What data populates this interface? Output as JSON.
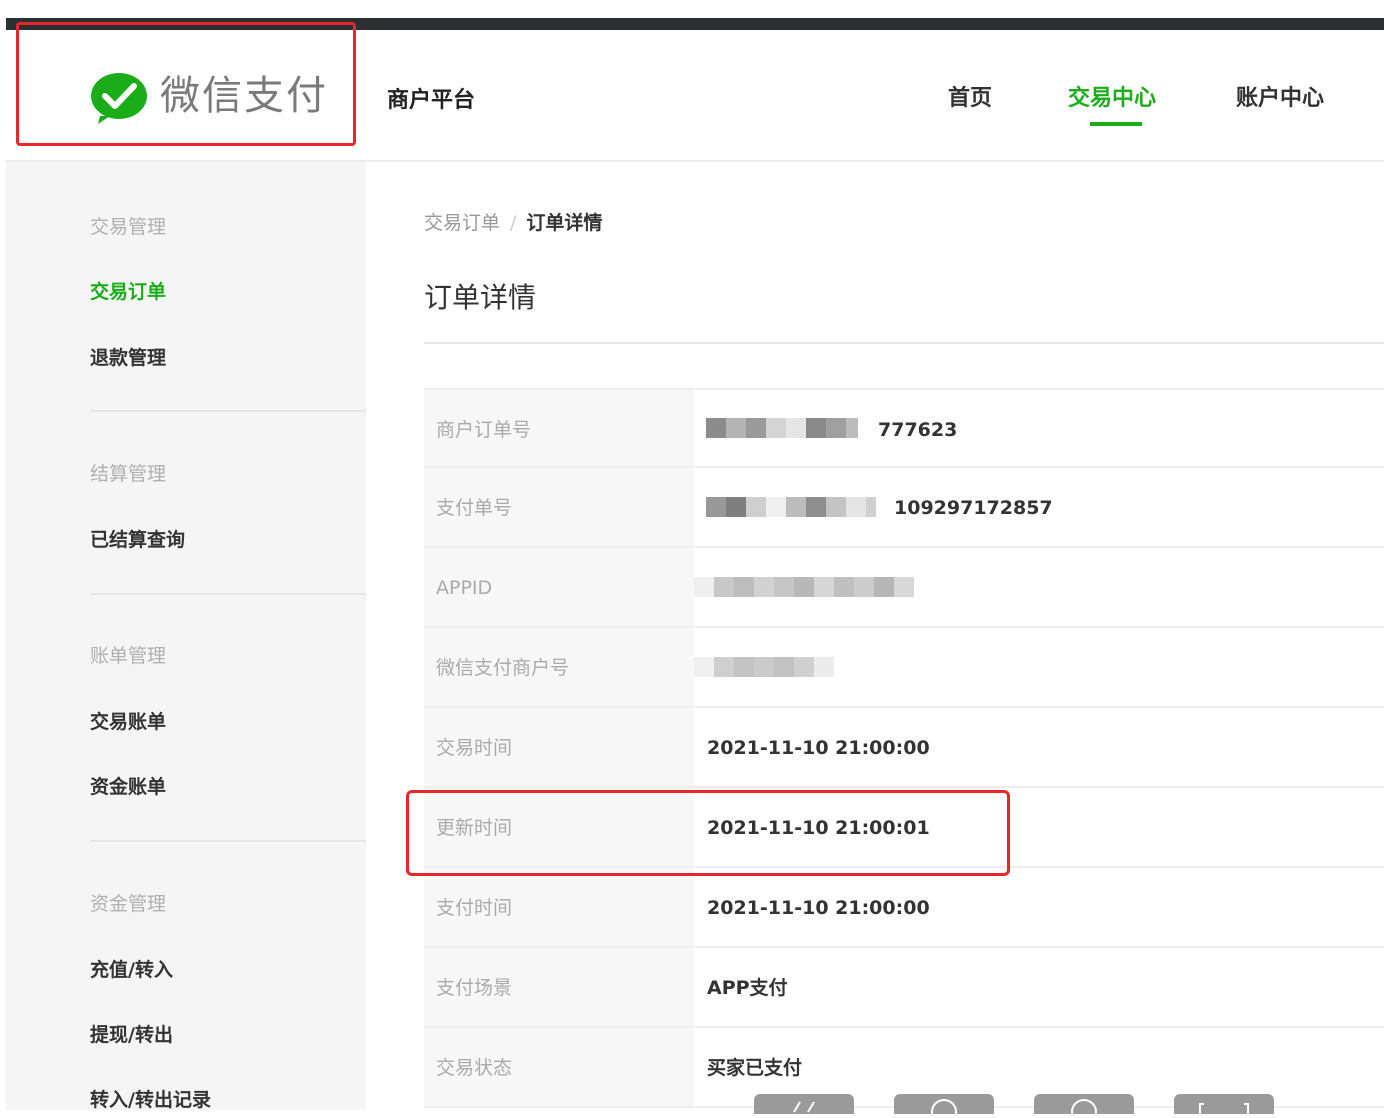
{
  "header": {
    "logo_text": "微信支付",
    "platform": "商户平台",
    "nav": [
      {
        "label": "首页",
        "active": false
      },
      {
        "label": "交易中心",
        "active": true
      },
      {
        "label": "账户中心",
        "active": false
      }
    ]
  },
  "sidebar": {
    "groups": [
      {
        "title": "交易管理",
        "items": [
          {
            "label": "交易订单",
            "active": true
          },
          {
            "label": "退款管理",
            "active": false
          }
        ]
      },
      {
        "title": "结算管理",
        "items": [
          {
            "label": "已结算查询",
            "active": false
          }
        ]
      },
      {
        "title": "账单管理",
        "items": [
          {
            "label": "交易账单",
            "active": false
          },
          {
            "label": "资金账单",
            "active": false
          }
        ]
      },
      {
        "title": "资金管理",
        "items": [
          {
            "label": "充值/转入",
            "active": false
          },
          {
            "label": "提现/转出",
            "active": false
          },
          {
            "label": "转入/转出记录",
            "active": false
          }
        ]
      }
    ]
  },
  "breadcrumb": {
    "parent": "交易订单",
    "separator": "/",
    "current": "订单详情"
  },
  "page_title": "订单详情",
  "details": [
    {
      "label": "商户订单号",
      "value": "777623",
      "masked": true
    },
    {
      "label": "支付单号",
      "value": "109297172857",
      "masked": true
    },
    {
      "label": "APPID",
      "value": "",
      "masked": true
    },
    {
      "label": "微信支付商户号",
      "value": "",
      "masked": true
    },
    {
      "label": "交易时间",
      "value": "2021-11-10 21:00:00",
      "masked": false
    },
    {
      "label": "更新时间",
      "value": "2021-11-10 21:00:01",
      "masked": false
    },
    {
      "label": "支付时间",
      "value": "2021-11-10 21:00:00",
      "masked": false
    },
    {
      "label": "支付场景",
      "value": "APP支付",
      "masked": false
    },
    {
      "label": "交易状态",
      "value": "买家已支付",
      "masked": false
    }
  ],
  "bottom_toolbar": [
    {
      "icon": "slash-icon"
    },
    {
      "icon": "circle-icon"
    },
    {
      "icon": "circle-icon"
    },
    {
      "icon": "bracket-icon"
    }
  ],
  "colors": {
    "accent": "#1aad19",
    "highlight": "#e8262b",
    "topbar": "#2b2e33"
  }
}
